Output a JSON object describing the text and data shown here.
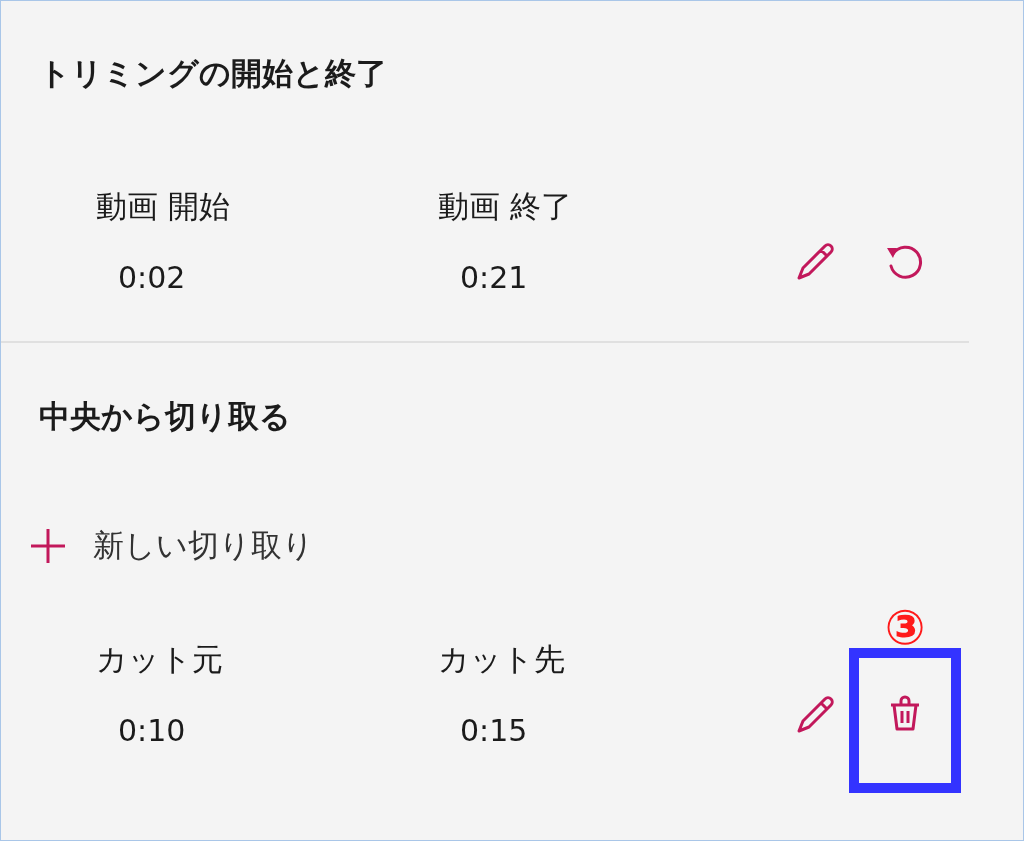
{
  "sections": [
    {
      "title": "トリミングの開始と終了",
      "rows": [
        {
          "fields": [
            {
              "label": "動画 開始",
              "value": "0:02"
            },
            {
              "label": "動画 終了",
              "value": "0:21"
            }
          ],
          "actions": [
            {
              "kind": "edit",
              "highlighted": false
            },
            {
              "kind": "reset",
              "highlighted": false
            }
          ]
        }
      ]
    },
    {
      "title": "中央から切り取る",
      "add_button": {
        "label": "新しい切り取り"
      },
      "rows": [
        {
          "fields": [
            {
              "label": "カット元",
              "value": "0:10"
            },
            {
              "label": "カット先",
              "value": "0:15"
            }
          ],
          "actions": [
            {
              "kind": "edit",
              "highlighted": false
            },
            {
              "kind": "delete",
              "highlighted": true,
              "callout": "③"
            }
          ]
        }
      ]
    }
  ]
}
